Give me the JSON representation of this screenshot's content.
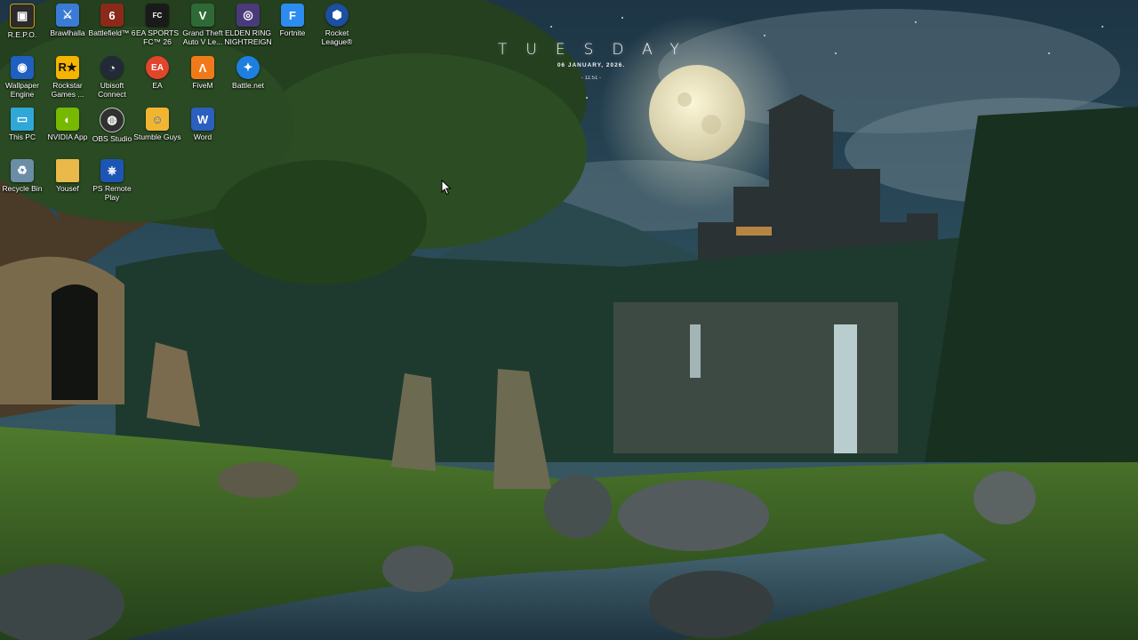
{
  "desktop": {
    "clock": {
      "day": "TUESDAY",
      "date": "06 JANUARY, 2026.",
      "time": "- 11:51 -"
    },
    "icons": [
      {
        "label": "R.E.P.O.",
        "icon": "repo-icon",
        "color": "#2b2b2b"
      },
      {
        "label": "Brawlhalla",
        "icon": "brawlhalla-icon",
        "color": "#3a7bd5"
      },
      {
        "label": "Battlefield™ 6",
        "icon": "battlefield-icon",
        "color": "#8b2a1a"
      },
      {
        "label": "EA SPORTS FC™ 26",
        "icon": "ea-fc-icon",
        "color": "#1a1a1a"
      },
      {
        "label": "Grand Theft Auto V Le...",
        "icon": "gta-icon",
        "color": "#2f6a36"
      },
      {
        "label": "ELDEN RING NIGHTREIGN",
        "icon": "elden-ring-icon",
        "color": "#4a3a7a"
      },
      {
        "label": "Fortnite",
        "icon": "fortnite-icon",
        "color": "#2d8cf0"
      },
      {
        "label": "Rocket League®",
        "icon": "rocket-league-icon",
        "color": "#1c4fa0"
      },
      {
        "label": "Wallpaper Engine",
        "icon": "wallpaper-engine-icon",
        "color": "#1f5fbf"
      },
      {
        "label": "Rockstar Games ...",
        "icon": "rockstar-icon",
        "color": "#f5b400"
      },
      {
        "label": "Ubisoft Connect",
        "icon": "ubisoft-icon",
        "color": "#222a3a"
      },
      {
        "label": "EA",
        "icon": "ea-icon",
        "color": "#e2452b"
      },
      {
        "label": "FiveM",
        "icon": "fivem-icon",
        "color": "#f07a1a"
      },
      {
        "label": "Battle.net",
        "icon": "battlenet-icon",
        "color": "#1e7fe0"
      },
      {
        "label": "This PC",
        "icon": "this-pc-icon",
        "color": "#2fa8d8"
      },
      {
        "label": "NVIDIA App",
        "icon": "nvidia-icon",
        "color": "#76b900"
      },
      {
        "label": "OBS Studio",
        "icon": "obs-icon",
        "color": "#303030"
      },
      {
        "label": "Stumble Guys",
        "icon": "stumble-guys-icon",
        "color": "#f2b531"
      },
      {
        "label": "Word",
        "icon": "word-icon",
        "color": "#2b5fc0"
      },
      {
        "label": "Recycle Bin",
        "icon": "recycle-bin-icon",
        "color": "#6c8da6"
      },
      {
        "label": "Yousef",
        "icon": "folder-icon",
        "color": "#e9b949"
      },
      {
        "label": "PS Remote Play",
        "icon": "ps-remote-play-icon",
        "color": "#1d55b5"
      }
    ]
  }
}
